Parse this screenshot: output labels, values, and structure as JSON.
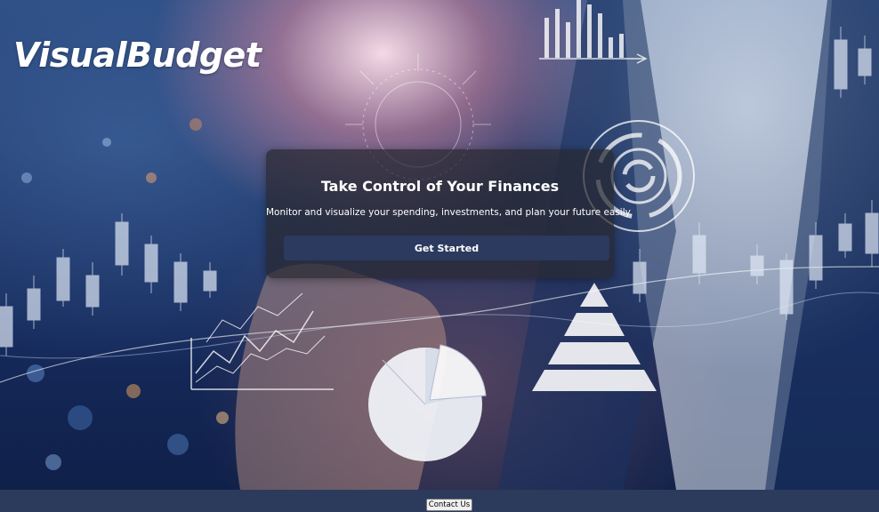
{
  "brand": {
    "name": "VisualBudget"
  },
  "hero": {
    "title": "Take Control of Your Finances",
    "subtitle": "Monitor and visualize your spending, investments, and plan your future easily.",
    "cta_label": "Get Started"
  },
  "footer": {
    "contact_label": "Contact Us"
  },
  "colors": {
    "card_background": "#2a2a30",
    "cta_button": "#2b3a5e",
    "footer_bar": "#2c3a5c"
  }
}
